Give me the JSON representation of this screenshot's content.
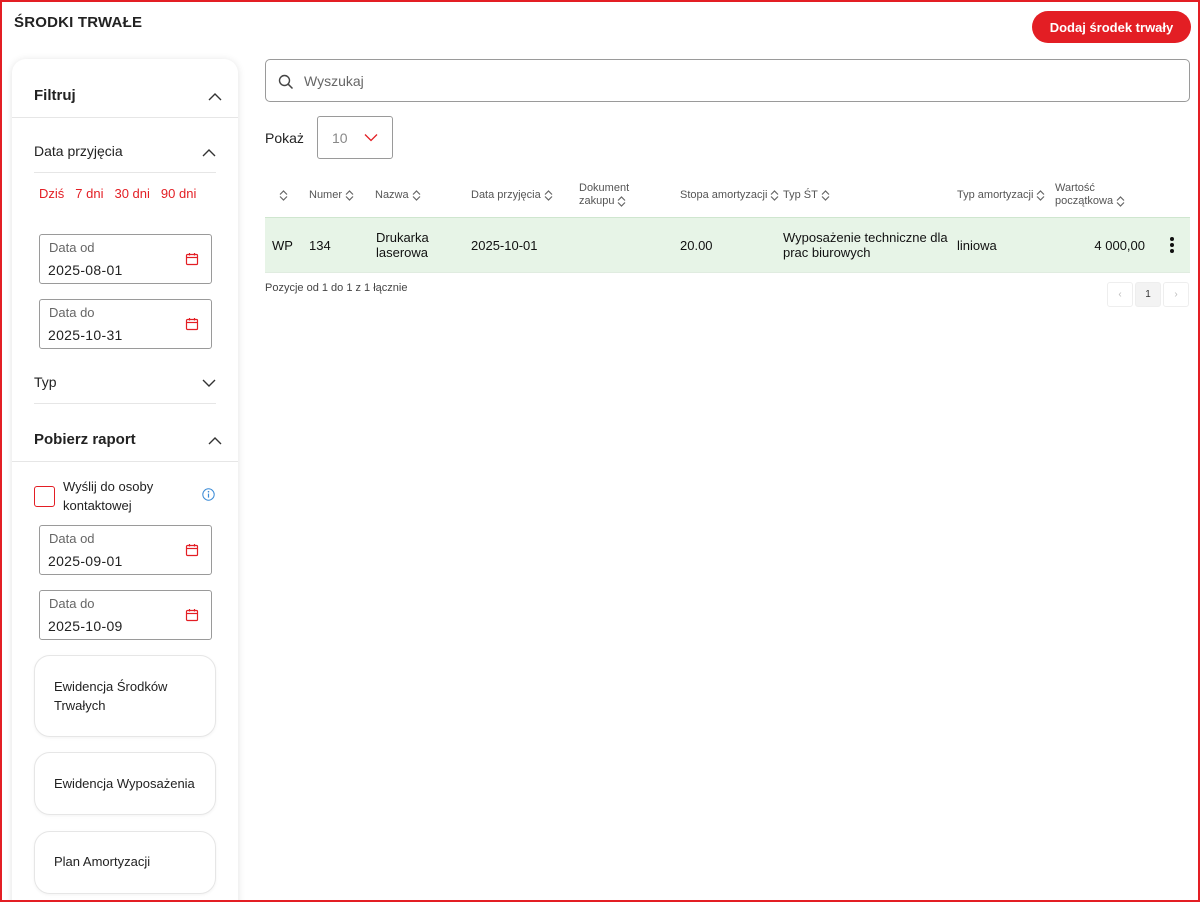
{
  "header": {
    "title": "ŚRODKI TRWAŁE",
    "add_button": "Dodaj środek trwały"
  },
  "sidebar": {
    "filter": {
      "title": "Filtruj",
      "date_section": "Data przyjęcia",
      "quick_links": [
        "Dziś",
        "7 dni",
        "30 dni",
        "90 dni"
      ],
      "date_from": {
        "label": "Data od",
        "value": "2025-08-01"
      },
      "date_to": {
        "label": "Data do",
        "value": "2025-10-31"
      },
      "type_section": "Typ"
    },
    "report": {
      "title": "Pobierz raport",
      "send_checkbox": "Wyślij do osoby kontaktowej",
      "date_from": {
        "label": "Data od",
        "value": "2025-09-01"
      },
      "date_to": {
        "label": "Data do",
        "value": "2025-10-09"
      },
      "cards": [
        "Ewidencja Środków Trwałych",
        "Ewidencja Wyposażenia",
        "Plan Amortyzacji"
      ]
    }
  },
  "search": {
    "placeholder": "Wyszukaj"
  },
  "page_size": {
    "label": "Pokaż",
    "value": "10"
  },
  "table": {
    "columns": {
      "numer": "Numer",
      "nazwa": "Nazwa",
      "data": "Data przyjęcia",
      "dokument": "Dokument zakupu",
      "stopa": "Stopa amortyzacji",
      "typ_st": "Typ ŚT",
      "typ_am": "Typ amortyzacji",
      "wartosc": "Wartość początkowa"
    },
    "rows": [
      {
        "prefix": "WP",
        "numer": "134",
        "nazwa": "Drukarka laserowa",
        "data": "2025-10-01",
        "dokument": "",
        "stopa": "20.00",
        "typ_st": "Wyposażenie techniczne dla prac biurowych",
        "typ_am": "liniowa",
        "wartosc": "4 000,00"
      }
    ],
    "summary": "Pozycje od 1 do 1 z 1 łącznie"
  },
  "pagination": {
    "prev": "‹",
    "current": "1",
    "next": "›"
  },
  "colors": {
    "accent": "#e31e24",
    "row_highlight": "#e7f4e7"
  }
}
